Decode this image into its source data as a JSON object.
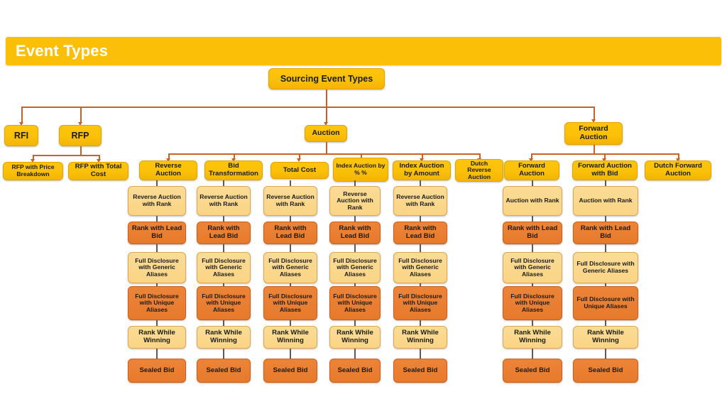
{
  "header": {
    "title": "Event Types",
    "bar_color": "#FCBF07",
    "title_color": "#FFFFFF"
  },
  "palette": {
    "gold": "#FBC00A",
    "amber": "#F9D485",
    "orange": "#E67A2C",
    "connector": "#C4622A",
    "background": "#FFFFFF"
  },
  "diagram": {
    "type": "tree",
    "root": {
      "label": "Sourcing Event Types",
      "color": "gold"
    },
    "level1": [
      {
        "label": "RFI",
        "color": "gold"
      },
      {
        "label": "RFP",
        "color": "gold"
      },
      {
        "label": "Auction",
        "color": "gold"
      },
      {
        "label": "Forward Auction",
        "color": "gold"
      }
    ],
    "rfp_children": [
      {
        "label": "RFP with Price Breakdown",
        "color": "gold"
      },
      {
        "label": "RFP with Total Cost",
        "color": "gold"
      }
    ],
    "auction_children": [
      {
        "label": "Reverse Auction",
        "color": "gold"
      },
      {
        "label": "Bid Transformation",
        "color": "gold"
      },
      {
        "label": "Total Cost",
        "color": "gold"
      },
      {
        "label": "Index Auction by % %",
        "color": "gold"
      },
      {
        "label": "Index Auction by Amount",
        "color": "gold"
      },
      {
        "label": "Dutch Reverse Auction",
        "color": "gold"
      }
    ],
    "forward_children": [
      {
        "label": "Forward Auction",
        "color": "gold"
      },
      {
        "label": "Forward Auction with Bid",
        "color": "gold"
      },
      {
        "label": "Dutch Forward Auction",
        "color": "gold"
      }
    ],
    "reverse_chain": [
      {
        "label": "Reverse Auction with Rank",
        "color": "amber"
      },
      {
        "label": "Rank with Lead Bid",
        "color": "orange"
      },
      {
        "label": "Full Disclosure with Generic Aliases",
        "color": "amber"
      },
      {
        "label": "Full Disclosure with Unique Aliases",
        "color": "orange"
      },
      {
        "label": "Rank While Winning",
        "color": "amber"
      },
      {
        "label": "Sealed Bid",
        "color": "orange"
      }
    ],
    "forward_chain": [
      {
        "label": "Auction with Rank",
        "color": "amber"
      },
      {
        "label": "Rank with Lead Bid",
        "color": "orange"
      },
      {
        "label": "Full Disclosure with Generic Aliases",
        "color": "amber"
      },
      {
        "label": "Full Disclosure with Unique Aliases",
        "color": "orange"
      },
      {
        "label": "Rank While Winning",
        "color": "amber"
      },
      {
        "label": "Sealed Bid",
        "color": "orange"
      }
    ],
    "reverse_chain_count": 5,
    "forward_chain_count": 2
  }
}
